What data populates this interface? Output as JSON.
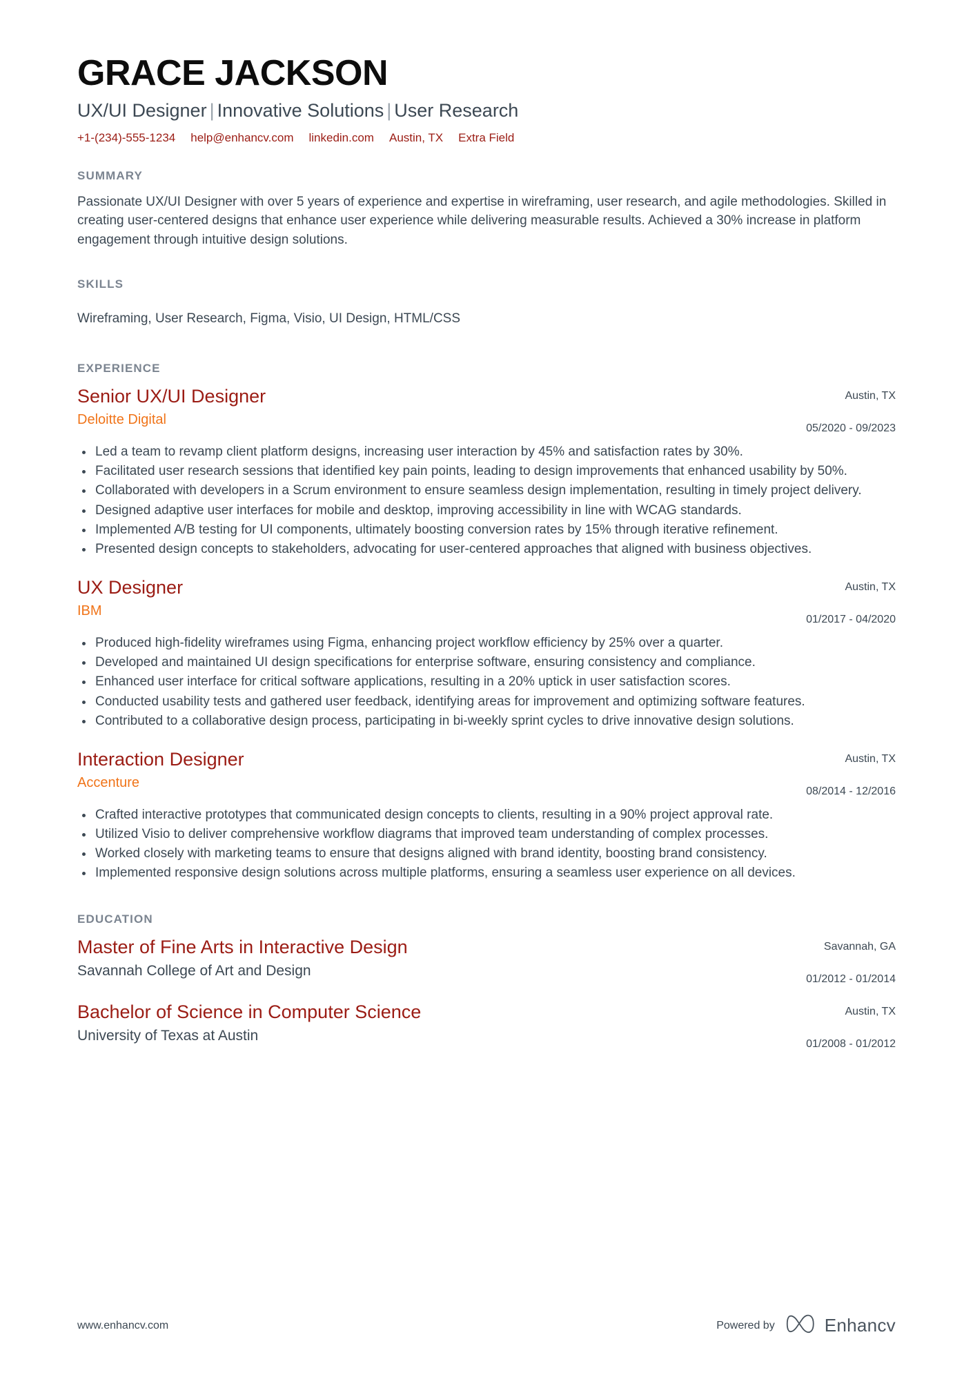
{
  "header": {
    "name": "GRACE JACKSON",
    "headline_parts": [
      "UX/UI Designer",
      "Innovative Solutions",
      "User Research"
    ],
    "headline_separator": "|",
    "contacts": [
      {
        "name": "phone",
        "value": "+1-(234)-555-1234"
      },
      {
        "name": "email",
        "value": "help@enhancv.com"
      },
      {
        "name": "linkedin",
        "value": "linkedin.com"
      },
      {
        "name": "location",
        "value": "Austin, TX"
      },
      {
        "name": "extra",
        "value": "Extra Field"
      }
    ],
    "accent_color": "#9b1c14"
  },
  "summary": {
    "title": "SUMMARY",
    "text": "Passionate UX/UI Designer with over 5 years of experience and expertise in wireframing, user research, and agile methodologies. Skilled in creating user-centered designs that enhance user experience while delivering measurable results. Achieved a 30% increase in platform engagement through intuitive design solutions."
  },
  "skills": {
    "title": "SKILLS",
    "list": "Wireframing, User Research, Figma, Visio, UI Design, HTML/CSS",
    "items": [
      "Wireframing",
      "User Research",
      "Figma",
      "Visio",
      "UI Design",
      "HTML/CSS"
    ]
  },
  "experience": {
    "title": "EXPERIENCE",
    "entries": [
      {
        "job_title": "Senior UX/UI Designer",
        "company": "Deloitte Digital",
        "location": "Austin, TX",
        "dates": "05/2020 - 09/2023",
        "bullets": [
          "Led a team to revamp client platform designs, increasing user interaction by 45% and satisfaction rates by 30%.",
          "Facilitated user research sessions that identified key pain points, leading to design improvements that enhanced usability by 50%.",
          "Collaborated with developers in a Scrum environment to ensure seamless design implementation, resulting in timely project delivery.",
          "Designed adaptive user interfaces for mobile and desktop, improving accessibility in line with WCAG standards.",
          "Implemented A/B testing for UI components, ultimately boosting conversion rates by 15% through iterative refinement.",
          "Presented design concepts to stakeholders, advocating for user-centered approaches that aligned with business objectives."
        ]
      },
      {
        "job_title": "UX Designer",
        "company": "IBM",
        "location": "Austin, TX",
        "dates": "01/2017 - 04/2020",
        "bullets": [
          "Produced high-fidelity wireframes using Figma, enhancing project workflow efficiency by 25% over a quarter.",
          "Developed and maintained UI design specifications for enterprise software, ensuring consistency and compliance.",
          "Enhanced user interface for critical software applications, resulting in a 20% uptick in user satisfaction scores.",
          "Conducted usability tests and gathered user feedback, identifying areas for improvement and optimizing software features.",
          "Contributed to a collaborative design process, participating in bi-weekly sprint cycles to drive innovative design solutions."
        ]
      },
      {
        "job_title": "Interaction Designer",
        "company": "Accenture",
        "location": "Austin, TX",
        "dates": "08/2014 - 12/2016",
        "bullets": [
          "Crafted interactive prototypes that communicated design concepts to clients, resulting in a 90% project approval rate.",
          "Utilized Visio to deliver comprehensive workflow diagrams that improved team understanding of complex processes.",
          "Worked closely with marketing teams to ensure that designs aligned with brand identity, boosting brand consistency.",
          "Implemented responsive design solutions across multiple platforms, ensuring a seamless user experience on all devices."
        ]
      }
    ]
  },
  "education": {
    "title": "EDUCATION",
    "entries": [
      {
        "degree": "Master of Fine Arts in Interactive Design",
        "school": "Savannah College of Art and Design",
        "location": "Savannah, GA",
        "dates": "01/2012 - 01/2014"
      },
      {
        "degree": "Bachelor of Science in Computer Science",
        "school": "University of Texas at Austin",
        "location": "Austin, TX",
        "dates": "01/2008 - 01/2012"
      }
    ]
  },
  "footer": {
    "url": "www.enhancv.com",
    "powered_by": "Powered by",
    "brand": "Enhancv"
  },
  "colors": {
    "title_red": "#9b1c14",
    "company_orange": "#f07419",
    "section_gray": "#7b8490",
    "body": "#3c4853"
  }
}
